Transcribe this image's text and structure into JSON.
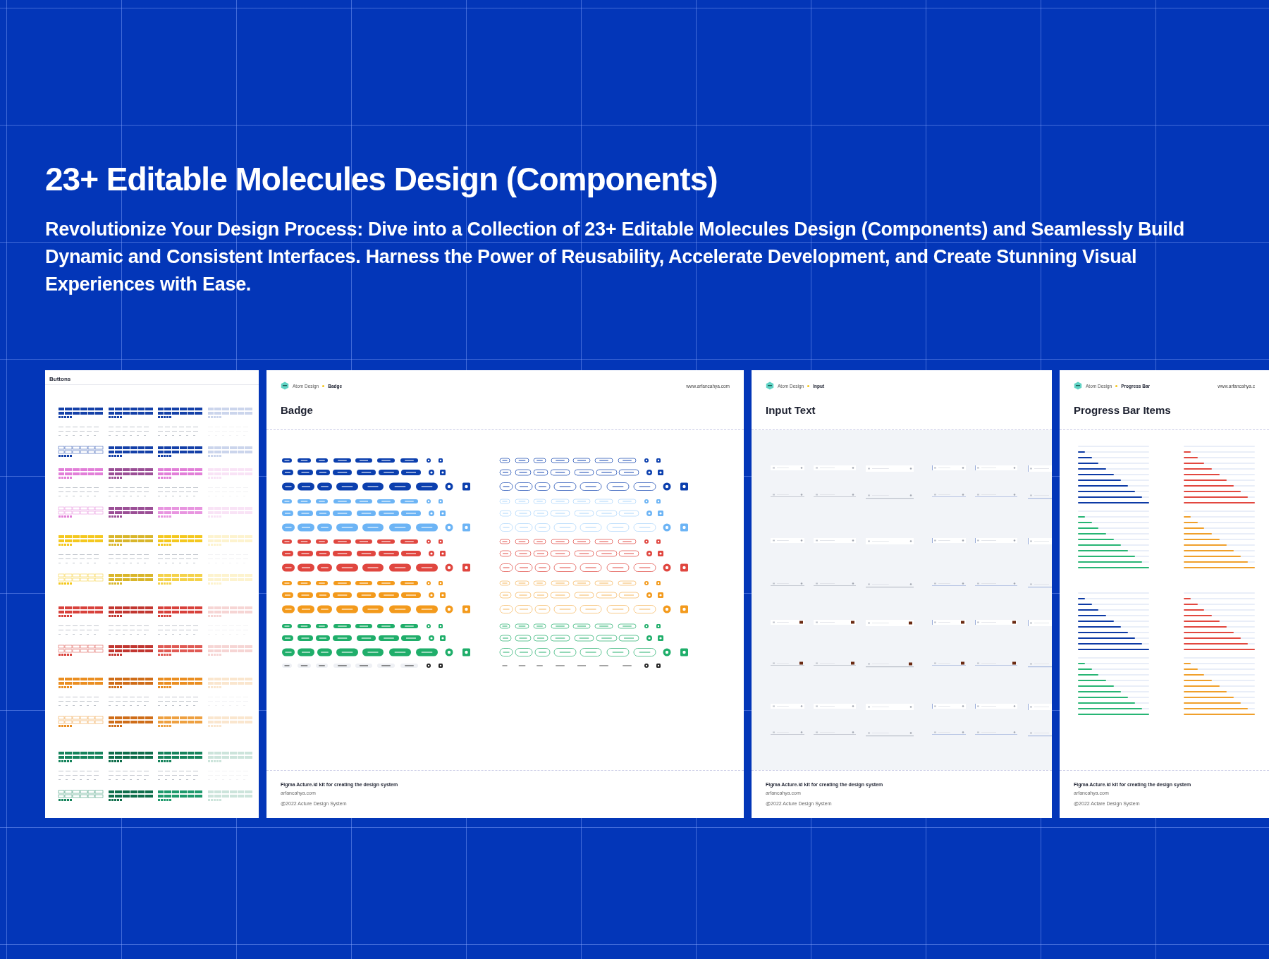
{
  "headline": "23+ Editable Molecules Design (Components)",
  "description": "Revolutionize Your Design Process: Dive into a Collection of 23+ Editable Molecules Design (Components) and Seamlessly Build Dynamic and Consistent Interfaces. Harness the Power of Reusability, Accelerate Development, and Create Stunning Visual Experiences with Ease.",
  "panels": [
    {
      "kind": "buttons",
      "title": "Buttons"
    },
    {
      "kind": "badge",
      "breadcrumb": {
        "root": "Atom Design",
        "page": "Badge"
      },
      "website": "www.arfancahya.com",
      "title": "Badge",
      "footer": {
        "heading": "Figma Acture.id kit for creating the design system",
        "link": "arfancahya.com",
        "copyright": "@2022 Acture Design System"
      }
    },
    {
      "kind": "input",
      "breadcrumb": {
        "root": "Atom Design",
        "page": "Input"
      },
      "title": "Input Text",
      "footer": {
        "heading": "Figma Acture.id kit for creating the design system",
        "link": "arfancahya.com",
        "copyright": "@2022 Acture Design System"
      }
    },
    {
      "kind": "progress",
      "breadcrumb": {
        "root": "Atom Design",
        "page": "Progress Bar"
      },
      "website": "www.arfancahya.c",
      "title": "Progress Bar Items",
      "footer": {
        "heading": "Figma Acture.id kit for creating the design system",
        "link": "arfancahya.com",
        "copyright": "@2022 Actare Design System"
      },
      "groups": [
        {
          "color": "#0d3aa5",
          "bars": [
            {
              "level": 0
            },
            {
              "level": 0.1
            },
            {
              "level": 0.2
            },
            {
              "level": 0.29
            },
            {
              "level": 0.4
            },
            {
              "level": 0.5
            },
            {
              "level": 0.6
            },
            {
              "level": 0.7
            },
            {
              "level": 0.8
            },
            {
              "level": 0.9
            },
            {
              "level": 1
            }
          ]
        },
        {
          "color": "#e2483f",
          "bars": [
            {
              "level": 0
            },
            {
              "level": 0.1
            },
            {
              "level": 0.2
            },
            {
              "level": 0.29
            },
            {
              "level": 0.4
            },
            {
              "level": 0.5
            },
            {
              "level": 0.6
            },
            {
              "level": 0.7
            },
            {
              "level": 0.8
            },
            {
              "level": 0.9
            },
            {
              "level": 1
            }
          ]
        },
        {
          "color": "#27b574",
          "bars": [
            {
              "level": 0
            },
            {
              "level": 0.1
            },
            {
              "level": 0.2
            },
            {
              "level": 0.29
            },
            {
              "level": 0.4
            },
            {
              "level": 0.5
            },
            {
              "level": 0.6
            },
            {
              "level": 0.7
            },
            {
              "level": 0.8
            },
            {
              "level": 0.9
            },
            {
              "level": 1
            }
          ]
        },
        {
          "color": "#f0a02b",
          "bars": [
            {
              "level": 0
            },
            {
              "level": 0.1
            },
            {
              "level": 0.2
            },
            {
              "level": 0.29
            },
            {
              "level": 0.4
            },
            {
              "level": 0.5
            },
            {
              "level": 0.6
            },
            {
              "level": 0.7
            },
            {
              "level": 0.8
            },
            {
              "level": 0.9
            },
            {
              "level": 1
            }
          ]
        },
        {
          "color": "#0d3aa5",
          "bars": [
            {
              "level": 0
            },
            {
              "level": 0.1
            },
            {
              "level": 0.2
            },
            {
              "level": 0.29
            },
            {
              "level": 0.4
            },
            {
              "level": 0.5
            },
            {
              "level": 0.6
            },
            {
              "level": 0.7
            },
            {
              "level": 0.8
            },
            {
              "level": 0.9
            },
            {
              "level": 1
            }
          ]
        },
        {
          "color": "#e2483f",
          "bars": [
            {
              "level": 0
            },
            {
              "level": 0.1
            },
            {
              "level": 0.2
            },
            {
              "level": 0.29
            },
            {
              "level": 0.4
            },
            {
              "level": 0.5
            },
            {
              "level": 0.6
            },
            {
              "level": 0.7
            },
            {
              "level": 0.8
            },
            {
              "level": 0.9
            },
            {
              "level": 1
            }
          ]
        },
        {
          "color": "#27b574",
          "bars": [
            {
              "level": 0
            },
            {
              "level": 0.1
            },
            {
              "level": 0.2
            },
            {
              "level": 0.29
            },
            {
              "level": 0.4
            },
            {
              "level": 0.5
            },
            {
              "level": 0.6
            },
            {
              "level": 0.7
            },
            {
              "level": 0.8
            },
            {
              "level": 0.9
            },
            {
              "level": 1
            }
          ]
        },
        {
          "color": "#f0a02b",
          "bars": [
            {
              "level": 0
            },
            {
              "level": 0.1
            },
            {
              "level": 0.2
            },
            {
              "level": 0.29
            },
            {
              "level": 0.4
            },
            {
              "level": 0.5
            },
            {
              "level": 0.6
            },
            {
              "level": 0.7
            },
            {
              "level": 0.8
            },
            {
              "level": 0.9
            },
            {
              "level": 1
            }
          ]
        }
      ]
    }
  ]
}
